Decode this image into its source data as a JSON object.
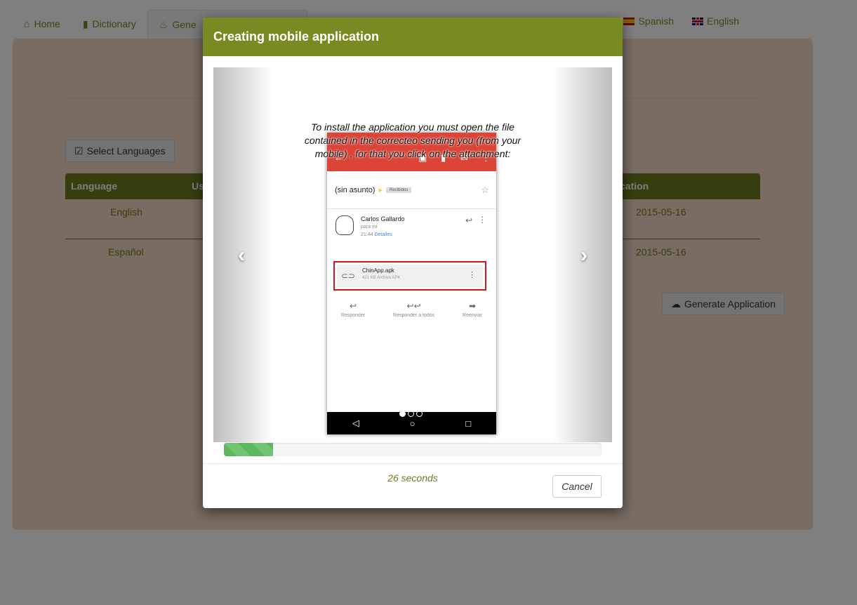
{
  "nav": {
    "tabs": [
      {
        "label": "Home",
        "icon": "home-icon"
      },
      {
        "label": "Dictionary",
        "icon": "book-icon"
      },
      {
        "label": "Gene",
        "icon": "fire-icon"
      }
    ],
    "languages": [
      {
        "label": "Spanish",
        "icon": "spain-flag-icon"
      },
      {
        "label": "English",
        "icon": "uk-flag-icon"
      }
    ]
  },
  "panel": {
    "select_languages_label": "Select Languages",
    "table": {
      "headers": [
        "Language",
        "Us",
        "cation"
      ],
      "rows": [
        {
          "language": "English",
          "date": "2015-05-16"
        },
        {
          "language": "Español",
          "date": "2015-05-16"
        }
      ]
    },
    "generate_label": "Generate Application"
  },
  "modal": {
    "title": "Creating mobile application",
    "caption": "To install the application you must open the file contained in the correcteo sending you (from your mobile) , for that you click on the attachment:",
    "phone": {
      "subject": "(sin asunto)",
      "tag": "Recibidos",
      "sender": "Carlos Gallardo",
      "to": "para mí",
      "time": "21:44",
      "details_link": "Detalles",
      "attachment_name": "ChinApp.apk",
      "attachment_size": "421 KB Archivo APK",
      "actions": [
        "Responder",
        "Responder a todos",
        "Reenviar"
      ]
    },
    "carousel": {
      "slide_count": 3,
      "active_index": 0
    },
    "progress_percent": 13,
    "timer": "26 seconds",
    "cancel_label": "Cancel"
  },
  "colors": {
    "accent": "#7a8a22",
    "panel_bg": "#f1d8c6",
    "gmail_red": "#db4437",
    "progress": "#5cb85c"
  }
}
